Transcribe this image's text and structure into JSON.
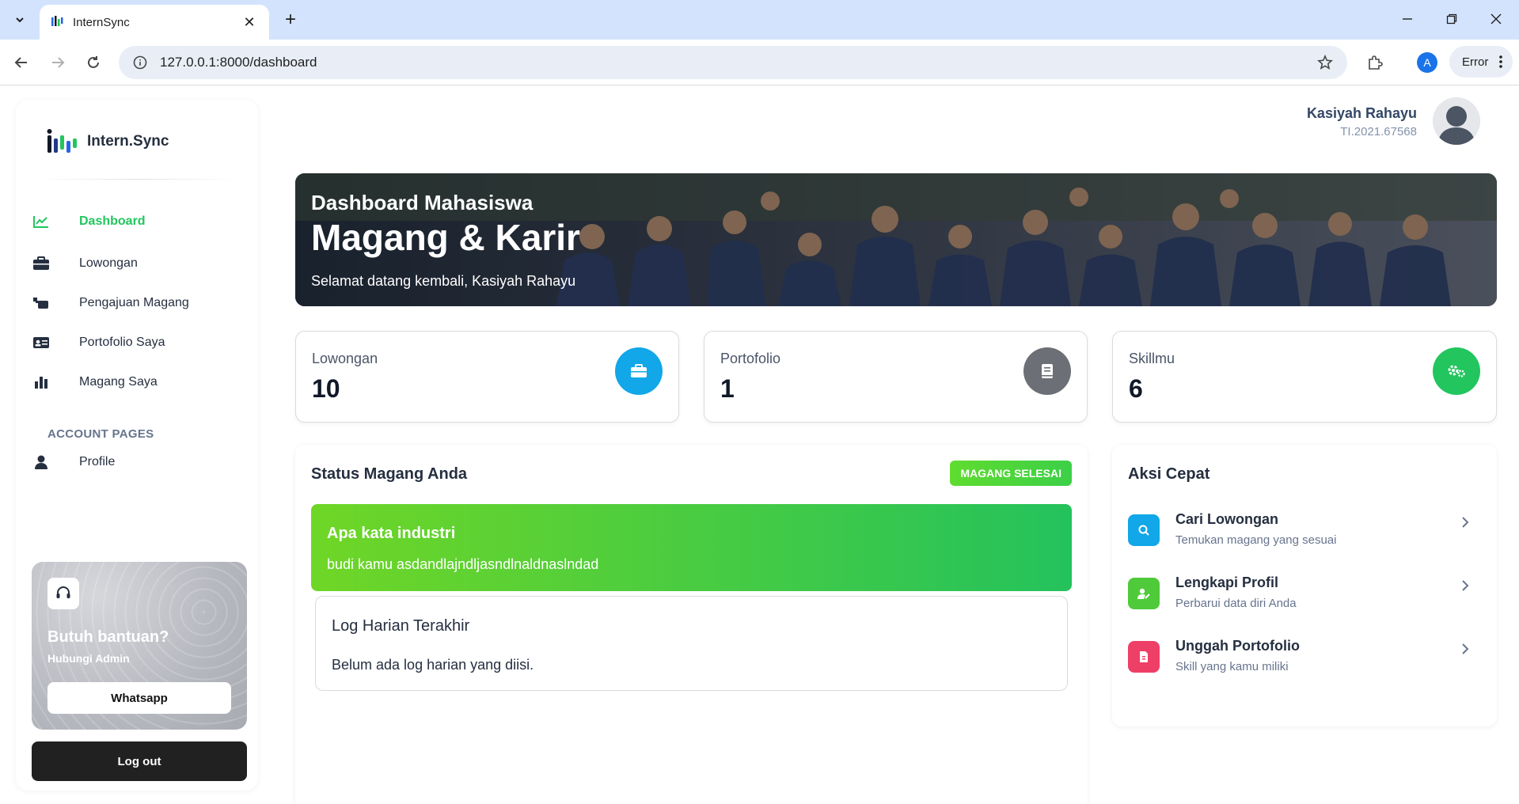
{
  "browser": {
    "tab_title": "InternSync",
    "url": "127.0.0.1:8000/dashboard",
    "profile_initial": "A",
    "error_label": "Error"
  },
  "sidebar": {
    "brand": "Intern.Sync",
    "items": [
      {
        "label": "Dashboard",
        "icon": "chart-line-icon"
      },
      {
        "label": "Lowongan",
        "icon": "briefcase-icon"
      },
      {
        "label": "Pengajuan Magang",
        "icon": "submission-icon"
      },
      {
        "label": "Portofolio Saya",
        "icon": "id-card-icon"
      },
      {
        "label": "Magang Saya",
        "icon": "bar-chart-icon"
      }
    ],
    "section_title": "ACCOUNT PAGES",
    "account_items": [
      {
        "label": "Profile",
        "icon": "user-icon"
      }
    ],
    "help": {
      "title": "Butuh bantuan?",
      "subtitle": "Hubungi Admin",
      "button": "Whatsapp"
    },
    "logout": "Log out"
  },
  "user": {
    "name": "Kasiyah Rahayu",
    "id": "TI.2021.67568"
  },
  "hero": {
    "overline": "Dashboard Mahasiswa",
    "title": "Magang & Karir",
    "welcome": "Selamat datang kembali, Kasiyah Rahayu"
  },
  "stats": [
    {
      "label": "Lowongan",
      "value": "10",
      "color": "#11a7e8",
      "icon": "briefcase-icon"
    },
    {
      "label": "Portofolio",
      "value": "1",
      "color": "#6c6f75",
      "icon": "book-icon"
    },
    {
      "label": "Skillmu",
      "value": "6",
      "color": "#22c55e",
      "icon": "gears-icon"
    }
  ],
  "status": {
    "title": "Status Magang Anda",
    "badge": "MAGANG SELESAI",
    "industry_title": "Apa kata industri",
    "industry_text": "budi kamu asdandlajndljasndlnaldnaslndad",
    "log_title": "Log Harian Terakhir",
    "log_empty": "Belum ada log harian yang diisi."
  },
  "quick": {
    "title": "Aksi Cepat",
    "actions": [
      {
        "title": "Cari Lowongan",
        "subtitle": "Temukan magang yang sesuai",
        "color": "#11a7e8",
        "icon": "search-icon"
      },
      {
        "title": "Lengkapi Profil",
        "subtitle": "Perbarui data diri Anda",
        "color": "#4fca3a",
        "icon": "user-edit-icon"
      },
      {
        "title": "Unggah Portofolio",
        "subtitle": "Skill yang kamu miliki",
        "color": "#ee3f67",
        "icon": "file-icon"
      }
    ]
  },
  "colors": {
    "accent_green": "#22c55e",
    "dark_button": "#212121"
  }
}
